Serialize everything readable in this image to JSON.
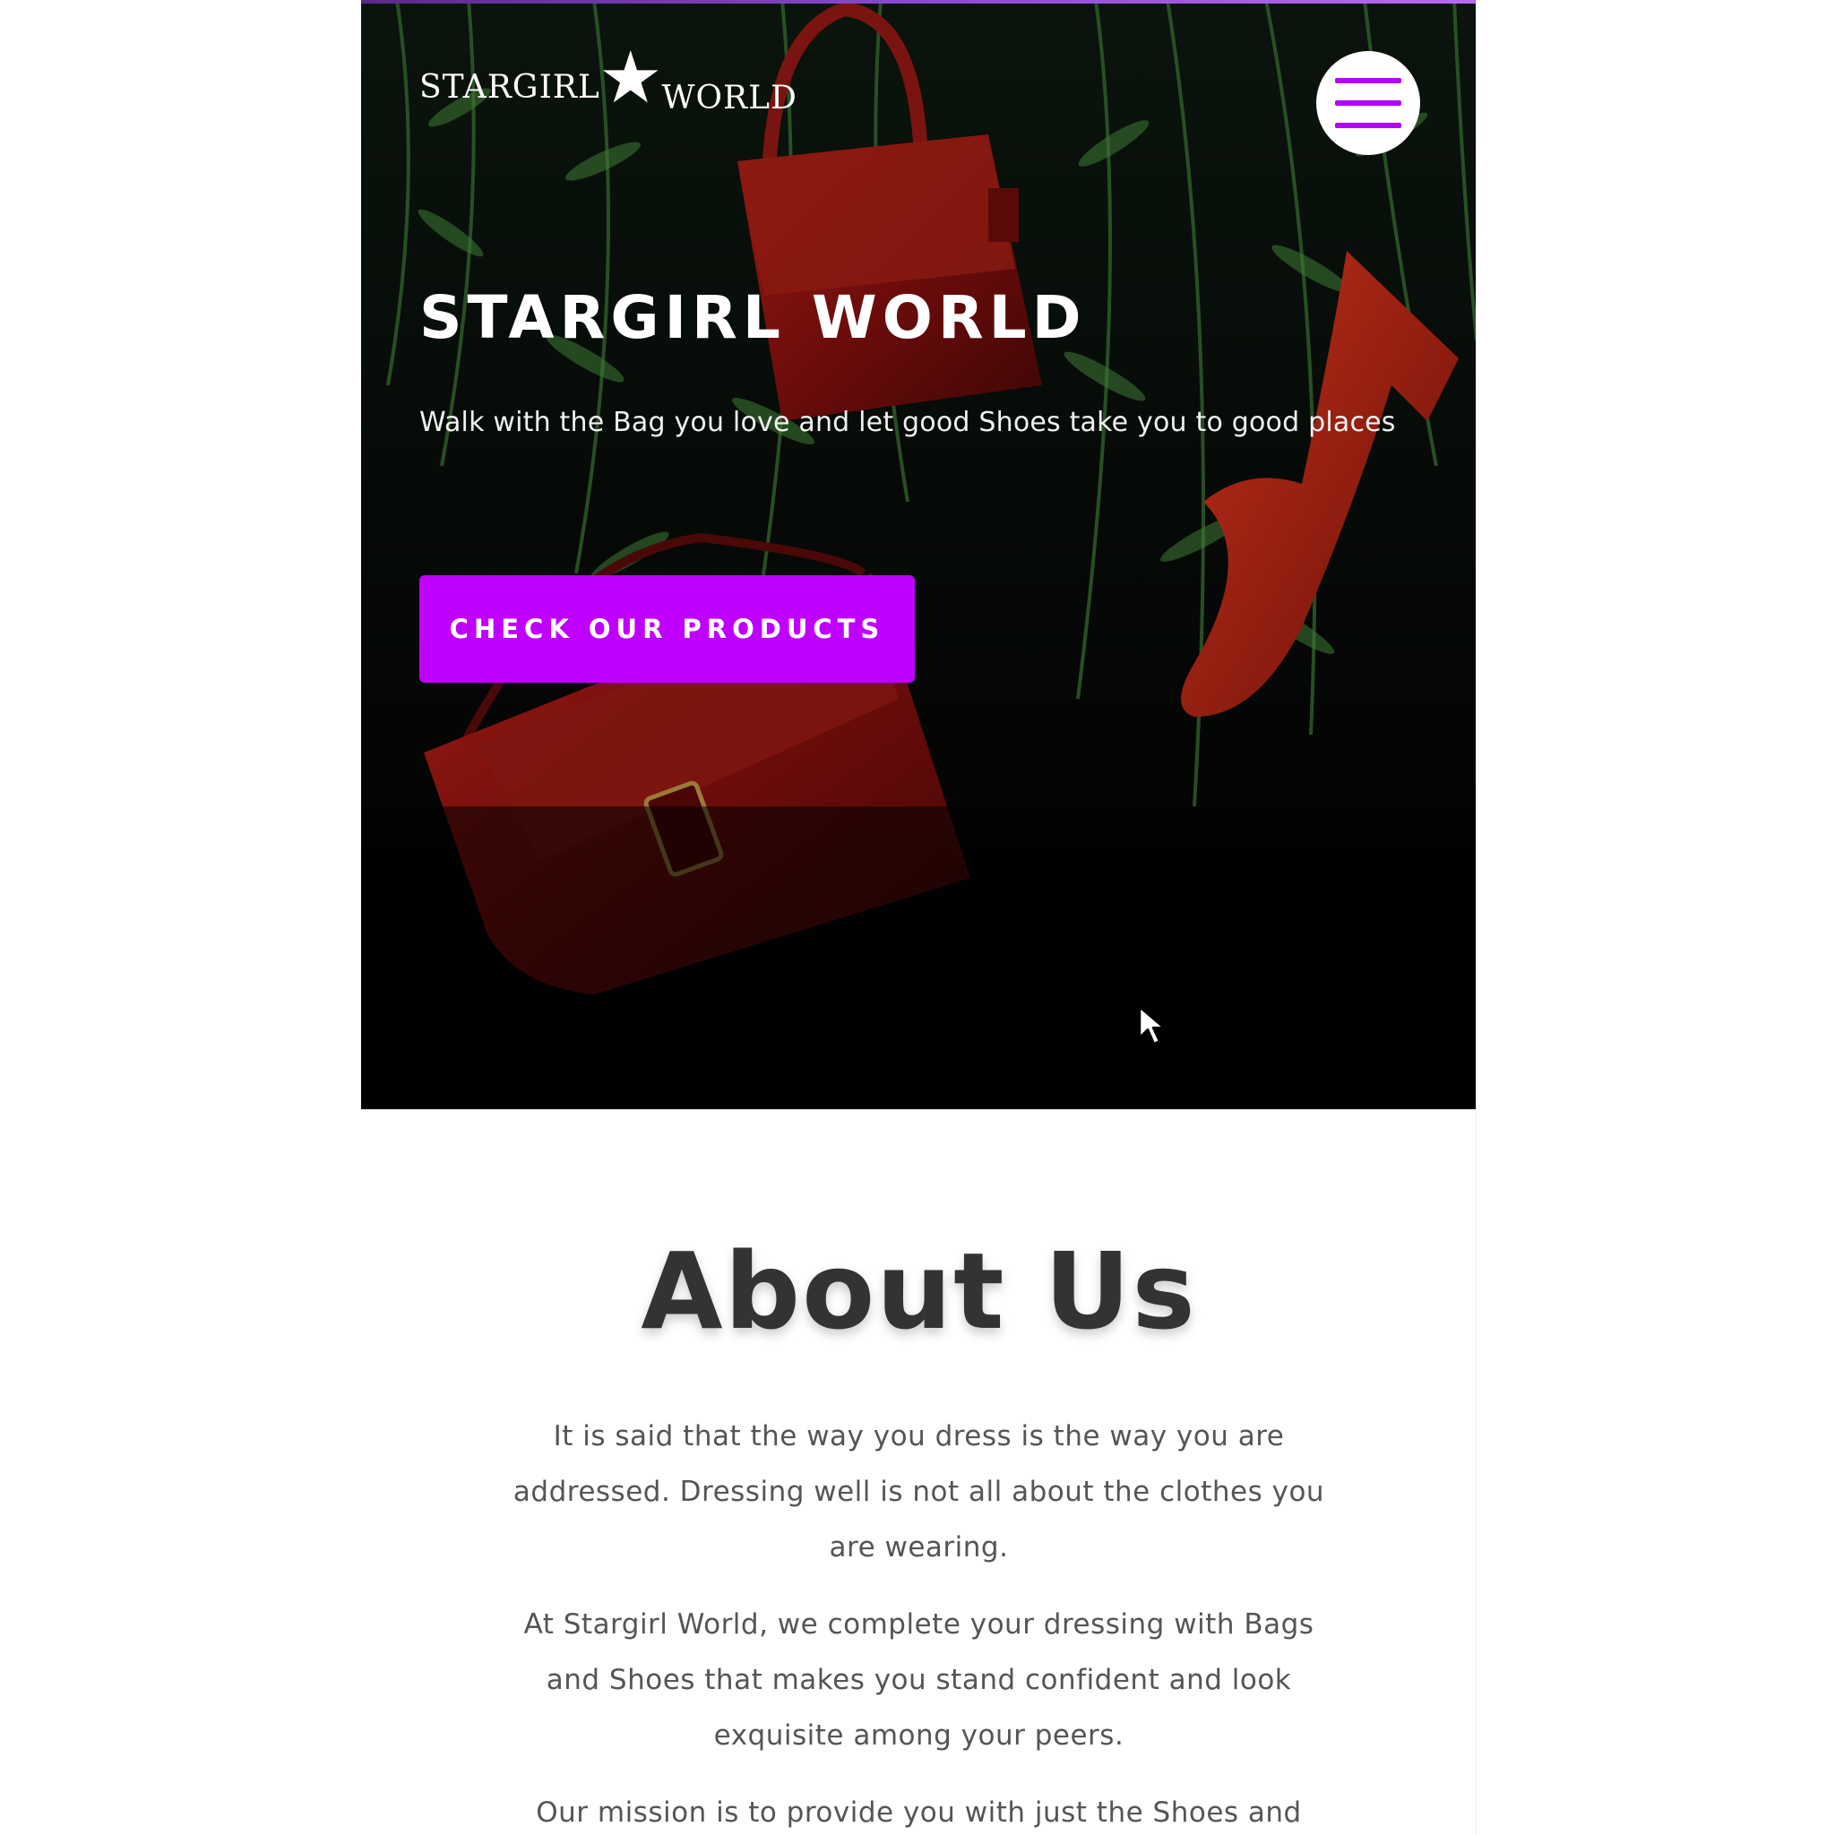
{
  "header": {
    "logo_left": "STARGIRL",
    "logo_star": "★",
    "logo_right": "WORLD",
    "menu_icon": "hamburger-icon"
  },
  "hero": {
    "title": "STARGIRL WORLD",
    "subtitle": "Walk with the Bag you love and let good Shoes take you to good places",
    "cta_label": "CHECK OUR PRODUCTS"
  },
  "about": {
    "title": "About Us",
    "paragraphs": [
      "It is said that the way you dress is the way you are addressed. Dressing well is not all about the clothes you are wearing.",
      "At Stargirl World, we complete your dressing with Bags and Shoes that makes you stand confident and look exquisite among your peers.",
      "Our mission is to provide you with just the Shoes and"
    ]
  },
  "colors": {
    "accent": "#c000ff",
    "hero_bg": "#000000",
    "title_text": "#333333",
    "body_text": "#555555"
  }
}
